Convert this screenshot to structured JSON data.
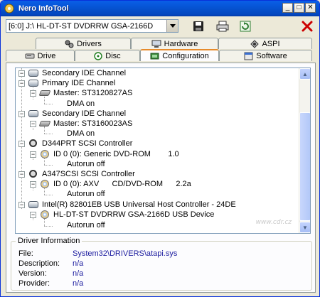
{
  "window": {
    "title": "Nero InfoTool",
    "minimize_glyph": "_",
    "maximize_glyph": "□",
    "close_glyph": "✕"
  },
  "toolbar": {
    "drive_value": "[6:0]  J:\\ HL-DT-ST DVDRRW GSA-2166D",
    "icons": [
      "save-icon",
      "print-icon",
      "refresh-icon",
      "exit-icon"
    ],
    "exit_color": "#cc0000"
  },
  "tabs": {
    "row1": [
      {
        "label": "Drivers",
        "icon": "drivers-icon"
      },
      {
        "label": "Hardware",
        "icon": "hardware-icon"
      },
      {
        "label": "ASPI",
        "icon": "aspi-icon"
      }
    ],
    "row2": [
      {
        "label": "Drive",
        "icon": "drive-icon"
      },
      {
        "label": "Disc",
        "icon": "disc-icon"
      },
      {
        "label": "Configuration",
        "icon": "configuration-icon",
        "active": true
      },
      {
        "label": "Software",
        "icon": "software-icon"
      }
    ]
  },
  "tree": {
    "items": [
      {
        "text": "Secondary IDE Channel",
        "icon": "ide-channel-icon"
      },
      {
        "text": "Primary IDE Channel",
        "icon": "ide-channel-icon"
      },
      {
        "text": "Master: ST3120827AS",
        "icon": "hard-disk-icon"
      },
      {
        "text": "DMA on"
      },
      {
        "text": "Secondary IDE Channel",
        "icon": "ide-channel-icon"
      },
      {
        "text": "Master: ST3160023AS",
        "icon": "hard-disk-icon"
      },
      {
        "text": "DMA on"
      },
      {
        "text": "D344PRT SCSI Controller",
        "icon": "scsi-controller-icon"
      },
      {
        "text": "ID 0 (0): Generic DVD-ROM        1.0",
        "icon": "optical-drive-icon"
      },
      {
        "text": "Autorun off"
      },
      {
        "text": "A347SCSI SCSI Controller",
        "icon": "scsi-controller-icon"
      },
      {
        "text": "ID 0 (0): AXV      CD/DVD-ROM      2.2a",
        "icon": "optical-drive-icon"
      },
      {
        "text": "Autorun off"
      },
      {
        "text": "Intel(R) 82801EB USB Universal Host Controller - 24DE",
        "icon": "usb-controller-icon"
      },
      {
        "text": "HL-DT-ST DVDRRW GSA-2166D USB Device",
        "icon": "optical-drive-icon"
      },
      {
        "text": "Autorun off"
      }
    ],
    "watermark": "www.cdr.cz"
  },
  "driver_info": {
    "legend": "Driver Information",
    "rows": [
      {
        "label": "File:",
        "value": "System32\\DRIVERS\\atapi.sys"
      },
      {
        "label": "Description:",
        "value": "n/a"
      },
      {
        "label": "Version:",
        "value": "n/a"
      },
      {
        "label": "Provider:",
        "value": "n/a"
      }
    ]
  }
}
